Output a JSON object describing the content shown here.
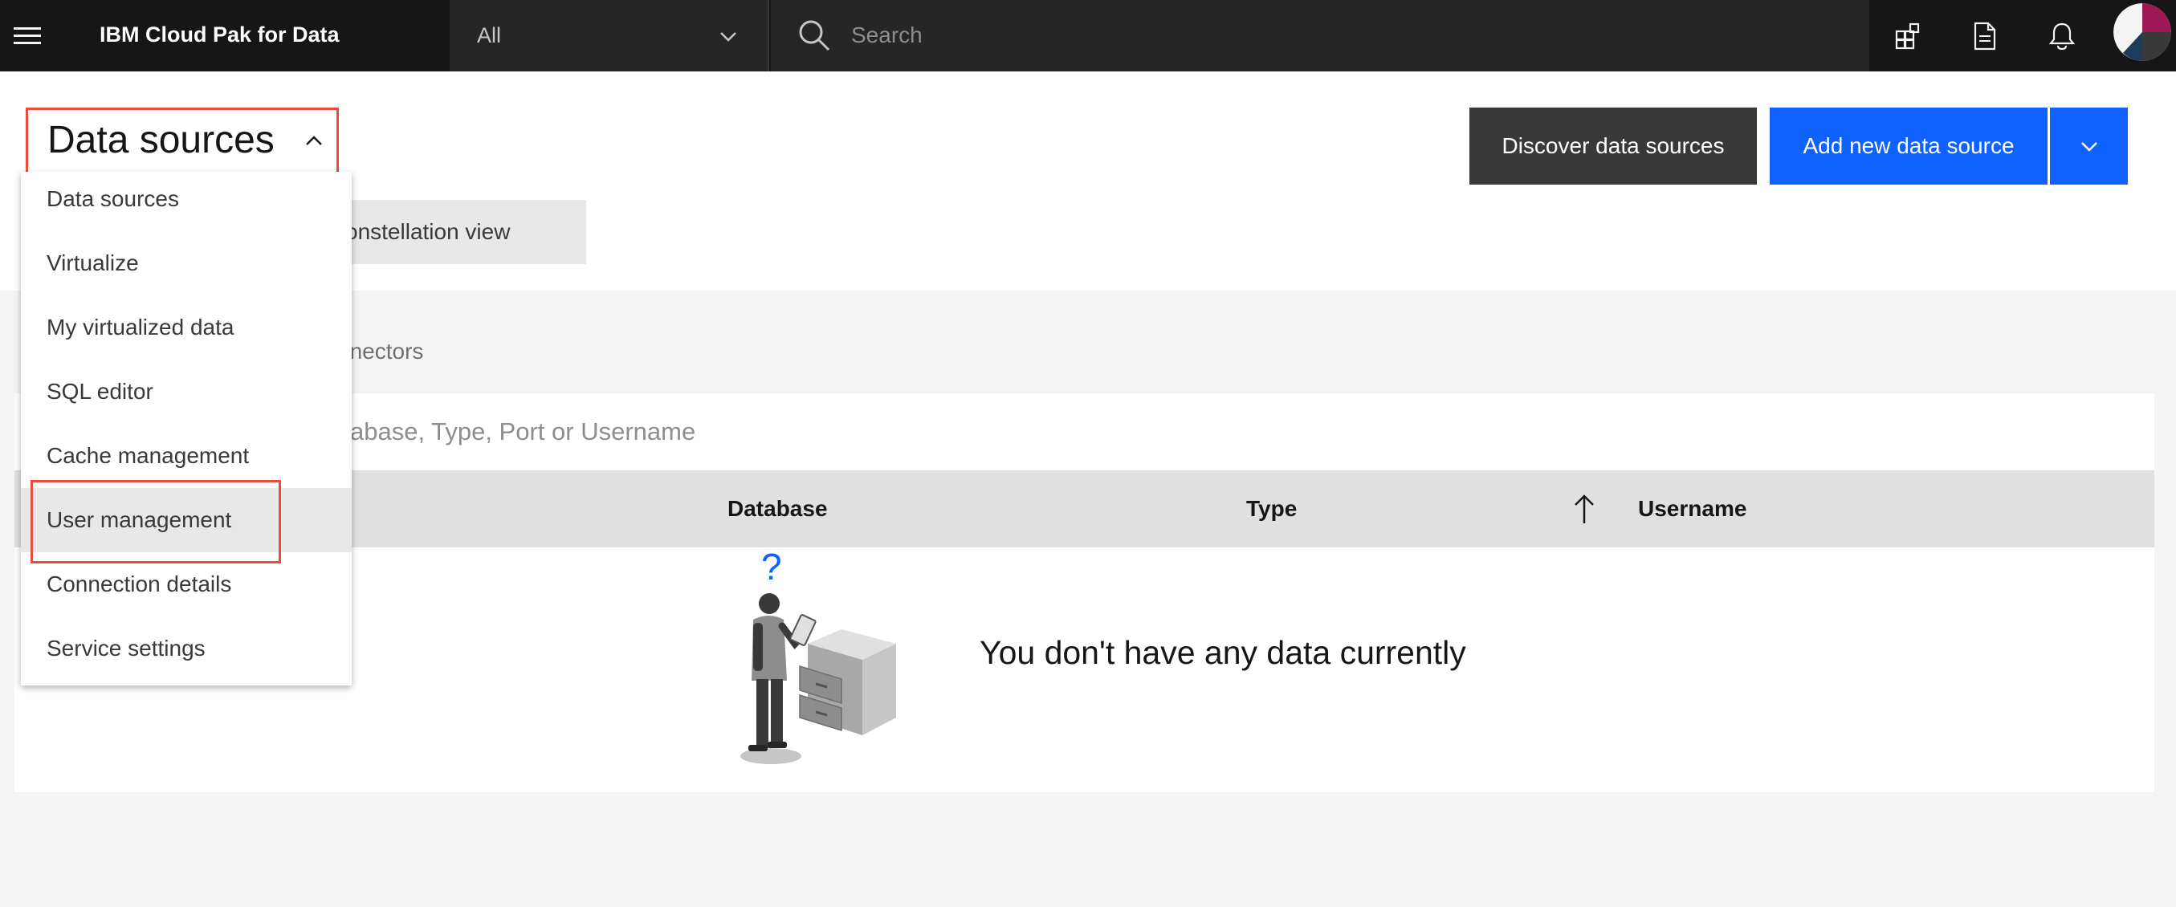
{
  "header": {
    "brand": "IBM Cloud Pak for Data",
    "scope_label": "All",
    "search_placeholder": "Search",
    "icons": [
      "menu-icon",
      "catalog-icon",
      "document-icon",
      "notification-icon",
      "user-avatar"
    ]
  },
  "page": {
    "title": "Data sources",
    "constellation_tab": "onstellation view",
    "discover_button": "Discover data sources",
    "add_button": "Add new data source"
  },
  "nav_menu": {
    "items": [
      {
        "label": "Data sources"
      },
      {
        "label": "Virtualize"
      },
      {
        "label": "My virtualized data"
      },
      {
        "label": "SQL editor"
      },
      {
        "label": "Cache management"
      },
      {
        "label": "User management"
      },
      {
        "label": "Connection details"
      },
      {
        "label": "Service settings"
      }
    ],
    "highlighted": "User management"
  },
  "content": {
    "tab_connectors": "nnectors",
    "filter_placeholder": "abase, Type, Port or Username",
    "columns": [
      "Database",
      "Type",
      "Username"
    ],
    "empty_message": "You don't have any data currently"
  },
  "colors": {
    "topbar": "#161616",
    "primary_blue": "#0f62fe",
    "highlight_red": "#e74c3c",
    "secondary_button": "#393939"
  }
}
